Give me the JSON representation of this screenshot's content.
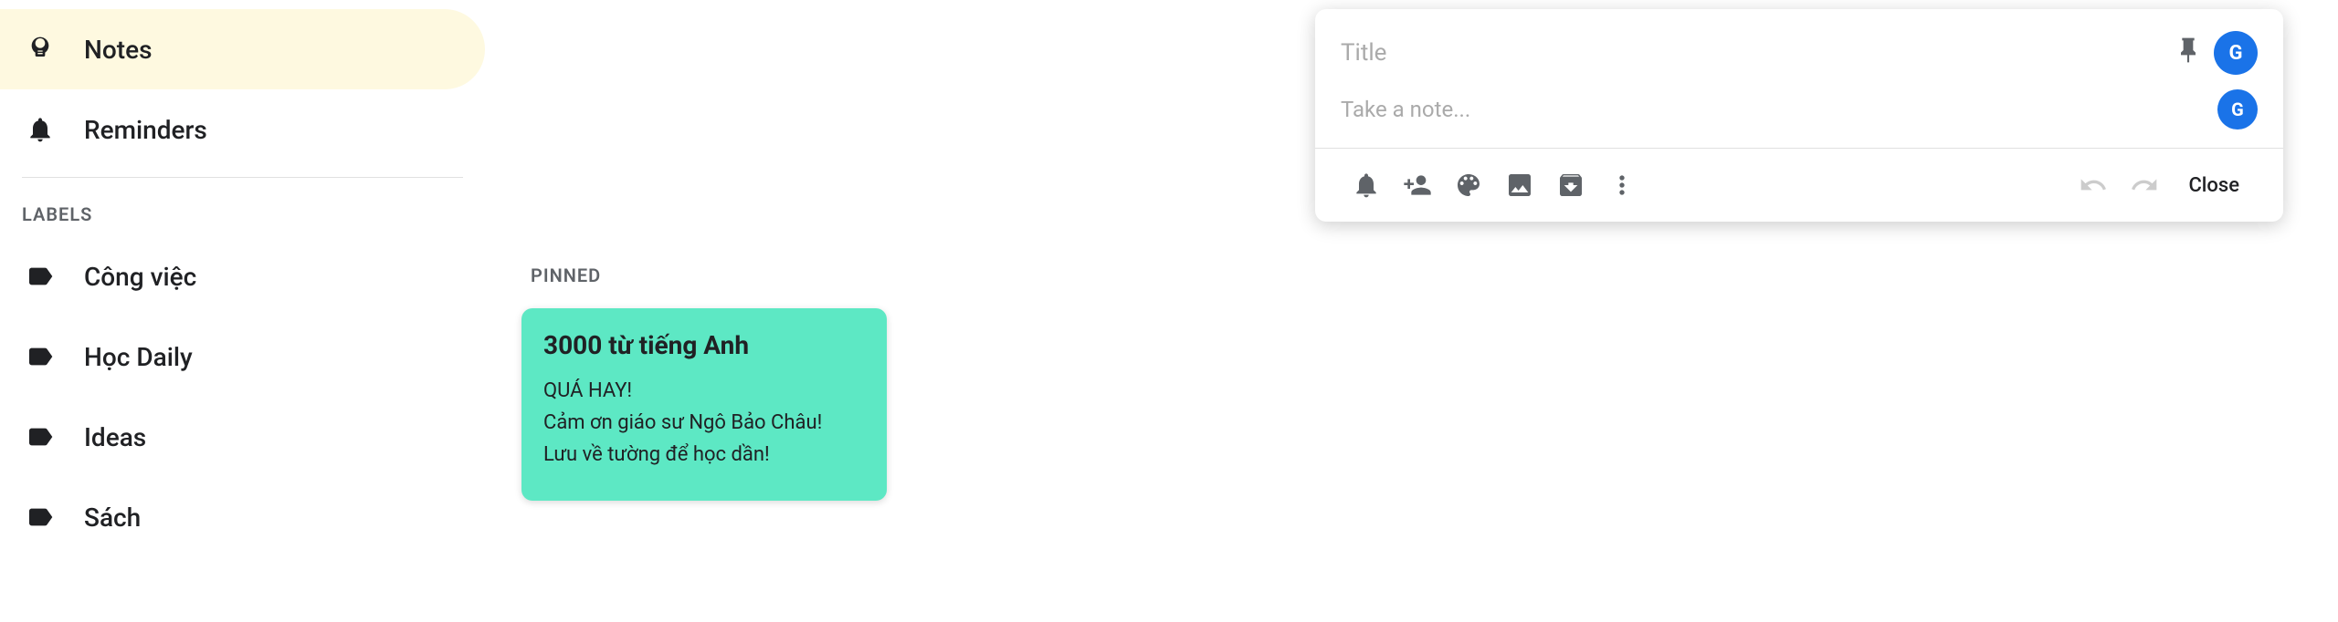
{
  "sidebar": {
    "items": [
      {
        "id": "notes",
        "label": "Notes",
        "active": true,
        "icon": "bulb"
      },
      {
        "id": "reminders",
        "label": "Reminders",
        "active": false,
        "icon": "bell"
      }
    ],
    "labels_heading": "LABELS",
    "labels": [
      {
        "id": "cong-viec",
        "label": "Công việc"
      },
      {
        "id": "hoc-daily",
        "label": "Học Daily"
      },
      {
        "id": "ideas",
        "label": "Ideas"
      },
      {
        "id": "sach",
        "label": "Sách"
      }
    ]
  },
  "main": {
    "pinned_label": "PINNED",
    "note_card": {
      "title": "3000 từ tiếng Anh",
      "body_line1": "QUÁ HAY!",
      "body_line2": "Cảm ơn giáo sư Ngô Bảo Châu!",
      "body_line3": "Lưu về tường để học dần!"
    }
  },
  "new_note": {
    "title_placeholder": "Title",
    "body_placeholder": "Take a note...",
    "avatar_letter": "G",
    "close_label": "Close",
    "toolbar": {
      "bell_title": "Remind me",
      "add_person_title": "Collaborator",
      "palette_title": "Background options",
      "image_title": "Add image",
      "archive_title": "More",
      "more_title": "More options",
      "undo_title": "Undo",
      "redo_title": "Redo"
    }
  }
}
